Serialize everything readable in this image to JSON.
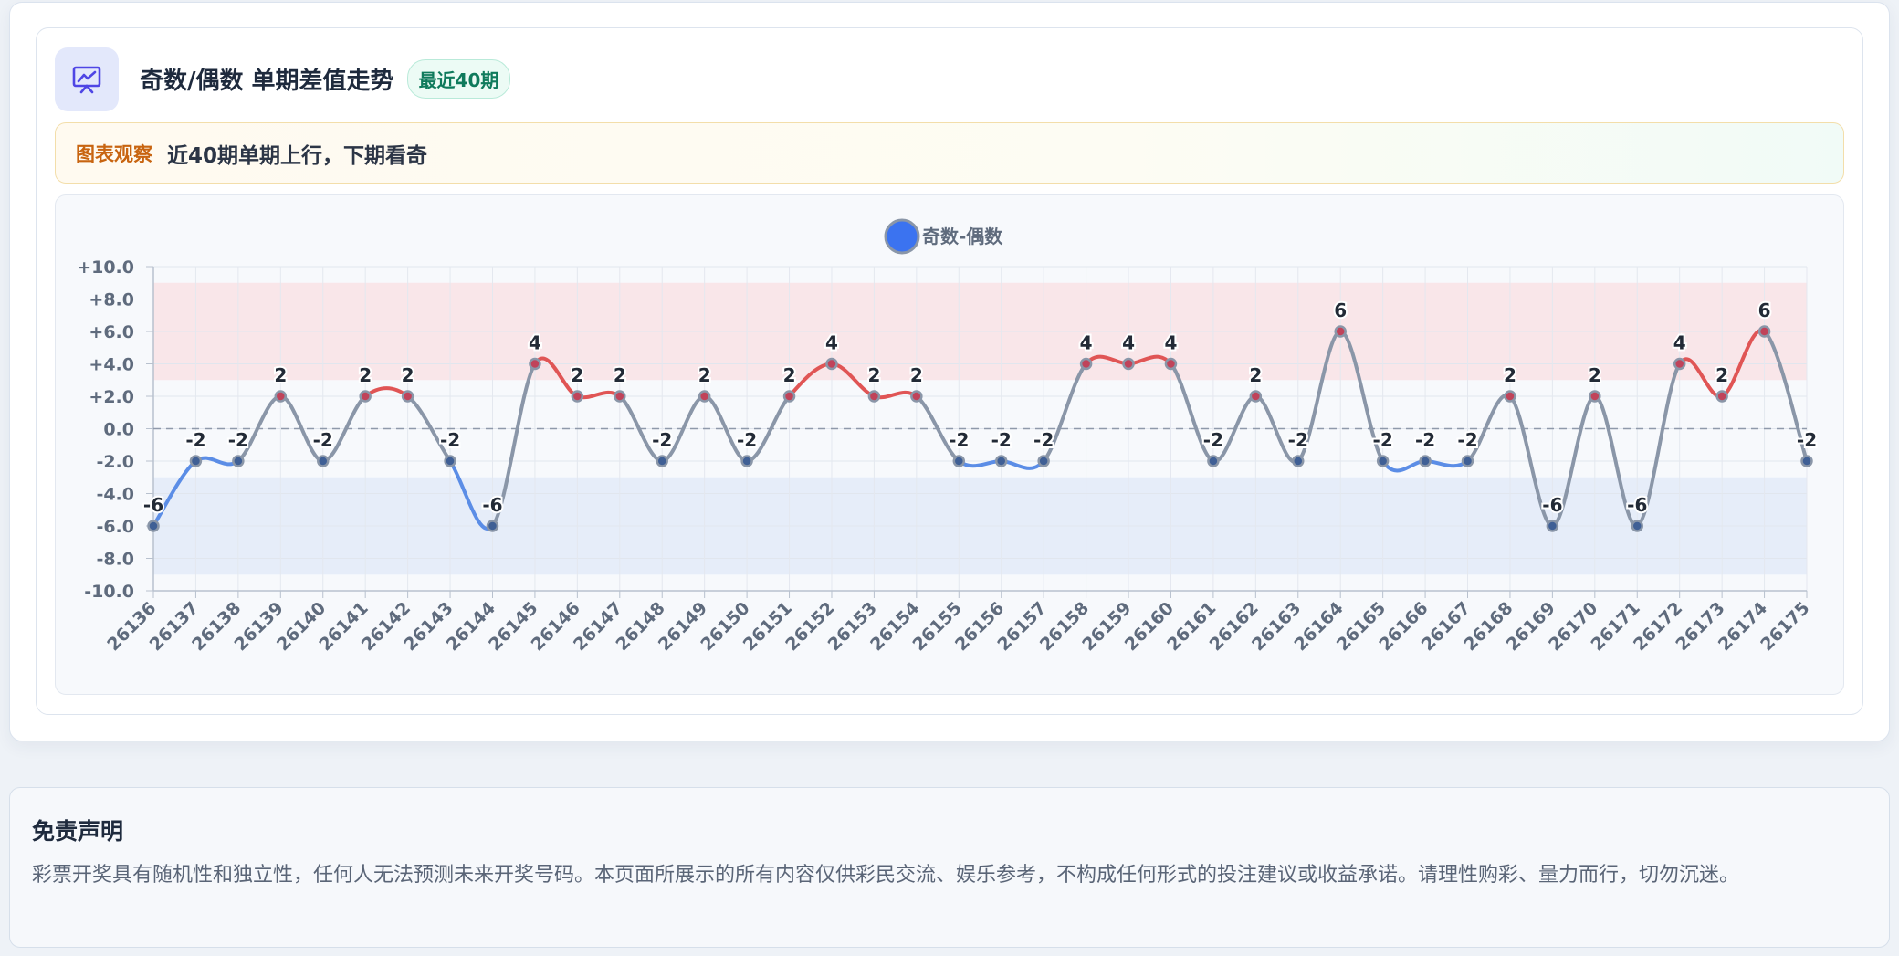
{
  "header": {
    "title": "奇数/偶数 单期差值走势",
    "badge": "最近40期",
    "icon": "presentation-chart-icon"
  },
  "observation": {
    "label": "图表观察",
    "text": "近40期单期上行，下期看奇"
  },
  "disclaimer": {
    "title": "免责声明",
    "text": "彩票开奖具有随机性和独立性，任何人无法预测未来开奖号码。本页面所展示的所有内容仅供彩民交流、娱乐参考，不构成任何形式的投注建议或收益承诺。请理性购彩、量力而行，切勿沉迷。"
  },
  "colors": {
    "positive": "#e05555",
    "negative": "#5b8de6",
    "neutral": "#8a96a8",
    "legend": "#3b73f0",
    "upper_band": "#f9e6e9",
    "lower_band": "#e6edf9"
  },
  "chart_data": {
    "type": "line",
    "title": "",
    "legend_position": "top-center",
    "series": [
      {
        "name": "奇数-偶数",
        "values": [
          -6,
          -2,
          -2,
          2,
          -2,
          2,
          2,
          -2,
          -6,
          4,
          2,
          2,
          -2,
          2,
          -2,
          2,
          4,
          2,
          2,
          -2,
          -2,
          -2,
          4,
          4,
          4,
          -2,
          2,
          -2,
          6,
          -2,
          -2,
          -2,
          2,
          -6,
          2,
          -6,
          4,
          2,
          6,
          -2
        ]
      }
    ],
    "categories": [
      "26136",
      "26137",
      "26138",
      "26139",
      "26140",
      "26141",
      "26142",
      "26143",
      "26144",
      "26145",
      "26146",
      "26147",
      "26148",
      "26149",
      "26150",
      "26151",
      "26152",
      "26153",
      "26154",
      "26155",
      "26156",
      "26157",
      "26158",
      "26159",
      "26160",
      "26161",
      "26162",
      "26163",
      "26164",
      "26165",
      "26166",
      "26167",
      "26168",
      "26169",
      "26170",
      "26171",
      "26172",
      "26173",
      "26174",
      "26175"
    ],
    "ylim": [
      -10,
      10
    ],
    "y_ticks": [
      "+10.0",
      "+8.0",
      "+6.0",
      "+4.0",
      "+2.0",
      "0.0",
      "-2.0",
      "-4.0",
      "-6.0",
      "-8.0",
      "-10.0"
    ],
    "y_tick_values": [
      10,
      8,
      6,
      4,
      2,
      0,
      -2,
      -4,
      -6,
      -8,
      -10
    ],
    "bands": [
      {
        "from": 3,
        "to": 9,
        "color": "#f9e6e9"
      },
      {
        "from": -9,
        "to": -3,
        "color": "#e6edf9"
      }
    ],
    "zero_line": true,
    "grid": true
  }
}
